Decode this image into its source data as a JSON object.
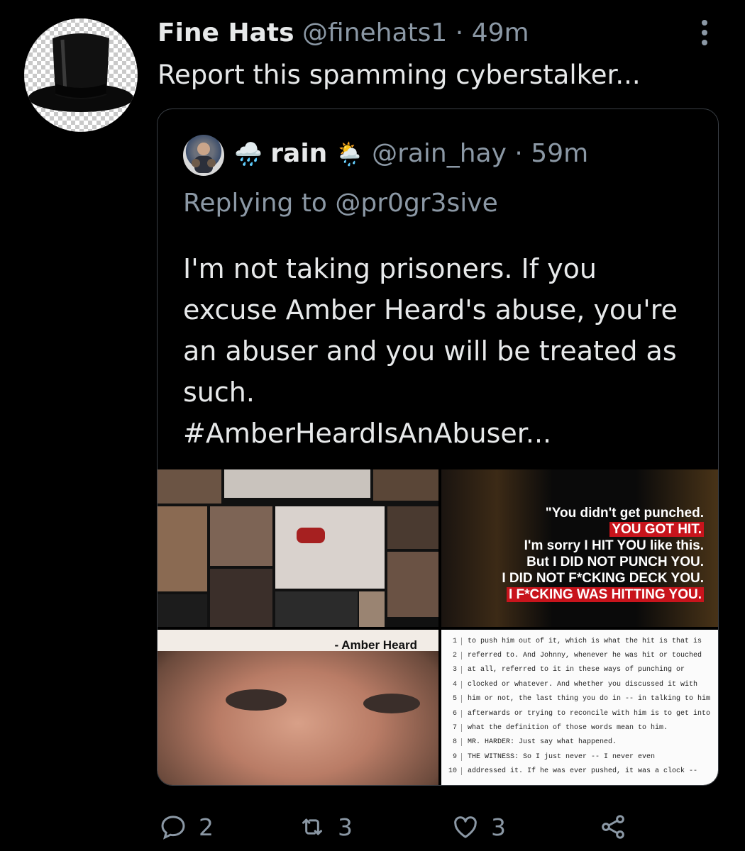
{
  "tweet": {
    "name": "Fine Hats",
    "handle": "@finehats1",
    "separator": "·",
    "time": "49m",
    "text": "Report this spamming cyberstalker..."
  },
  "quoted": {
    "name": "rain",
    "emoji_before": "🌧️",
    "emoji_after": "🌦️",
    "handle": "@rain_hay",
    "separator": "·",
    "time": "59m",
    "replying": "Replying to @pr0gr3sive",
    "body_lines": [
      "I'm not taking prisoners. If you",
      "excuse Amber Heard's abuse, you're",
      "an abuser and you will be treated as",
      "such.",
      "#AmberHeardIsAnAbuser..."
    ],
    "media": {
      "quote_card": [
        "\"You didn't get punched.",
        "YOU GOT HIT.",
        "I'm sorry I HIT YOU like this.",
        "But I DID NOT PUNCH YOU.",
        "I DID NOT F*CKING DECK YOU.",
        "I F*CKING WAS HITTING YOU."
      ],
      "face_caption": "- Amber Heard",
      "transcript": [
        {
          "n": "1",
          "text": "to push him out of it, which is what the hit is that is"
        },
        {
          "n": "2",
          "text": "referred to.  And Johnny, whenever he was hit or touched"
        },
        {
          "n": "3",
          "text": "at all, referred to it in these ways of punching or"
        },
        {
          "n": "4",
          "text": "clocked or whatever.  And whether you discussed it with"
        },
        {
          "n": "5",
          "text": "him or not, the last thing you do in -- in talking to him"
        },
        {
          "n": "6",
          "text": "afterwards or trying to reconcile with him is to get into"
        },
        {
          "n": "7",
          "text": "what the definition of those words mean to him."
        },
        {
          "n": "8",
          "text": "        MR. HARDER:  Just say what happened."
        },
        {
          "n": "9",
          "text": "        THE WITNESS:  So I just never -- I never even"
        },
        {
          "n": "10",
          "text": "addressed it.  If he was ever pushed, it was a clock --"
        }
      ]
    }
  },
  "actions": {
    "replies": "2",
    "retweets": "3",
    "likes": "3"
  },
  "icons": {
    "reply": "reply-icon",
    "retweet": "retweet-icon",
    "like": "heart-icon",
    "share": "share-icon",
    "more": "more-icon"
  },
  "colors": {
    "background": "#000000",
    "text": "#e7e9ea",
    "secondary": "#8b98a5",
    "border": "#3a3f45"
  }
}
